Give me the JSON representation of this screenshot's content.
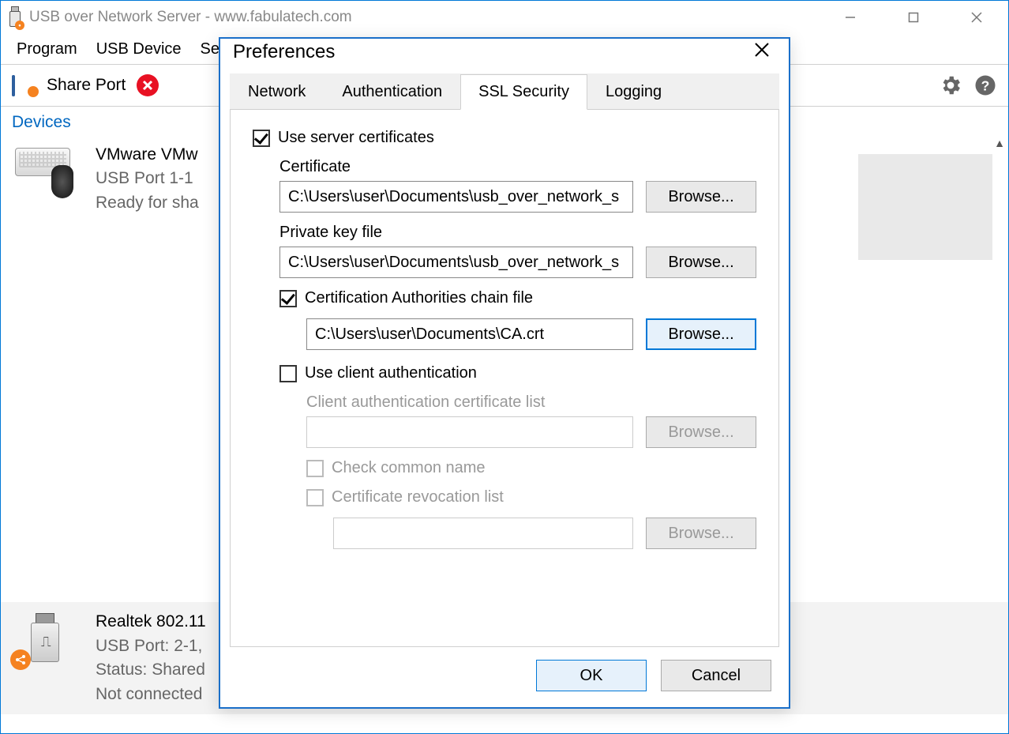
{
  "window": {
    "title": "USB over Network Server - www.fabulatech.com"
  },
  "menubar": [
    "Program",
    "USB Device",
    "Set"
  ],
  "toolbar": {
    "share_label": "Share Port"
  },
  "devices_header": "Devices",
  "devices": [
    {
      "name": "VMware VMw",
      "port": "USB Port   1-1",
      "status": "Ready for sha"
    },
    {
      "name": "Realtek 802.11",
      "port": "USB Port: 2-1,",
      "status": "Status: Shared",
      "conn": "Not connected"
    }
  ],
  "dialog": {
    "title": "Preferences",
    "tabs": [
      "Network",
      "Authentication",
      "SSL Security",
      "Logging"
    ],
    "active_tab_index": 2,
    "use_server_certs_label": "Use server certificates",
    "certificate_label": "Certificate",
    "certificate_value": "C:\\Users\\user\\Documents\\usb_over_network_s",
    "private_key_label": "Private key file",
    "private_key_value": "C:\\Users\\user\\Documents\\usb_over_network_s",
    "ca_chain_label": "Certification Authorities chain file",
    "ca_chain_value": "C:\\Users\\user\\Documents\\CA.crt",
    "use_client_auth_label": "Use client authentication",
    "client_cert_list_label": "Client authentication certificate list",
    "check_common_name_label": "Check common name",
    "crl_label": "Certificate revocation list",
    "browse_label": "Browse...",
    "ok_label": "OK",
    "cancel_label": "Cancel"
  }
}
